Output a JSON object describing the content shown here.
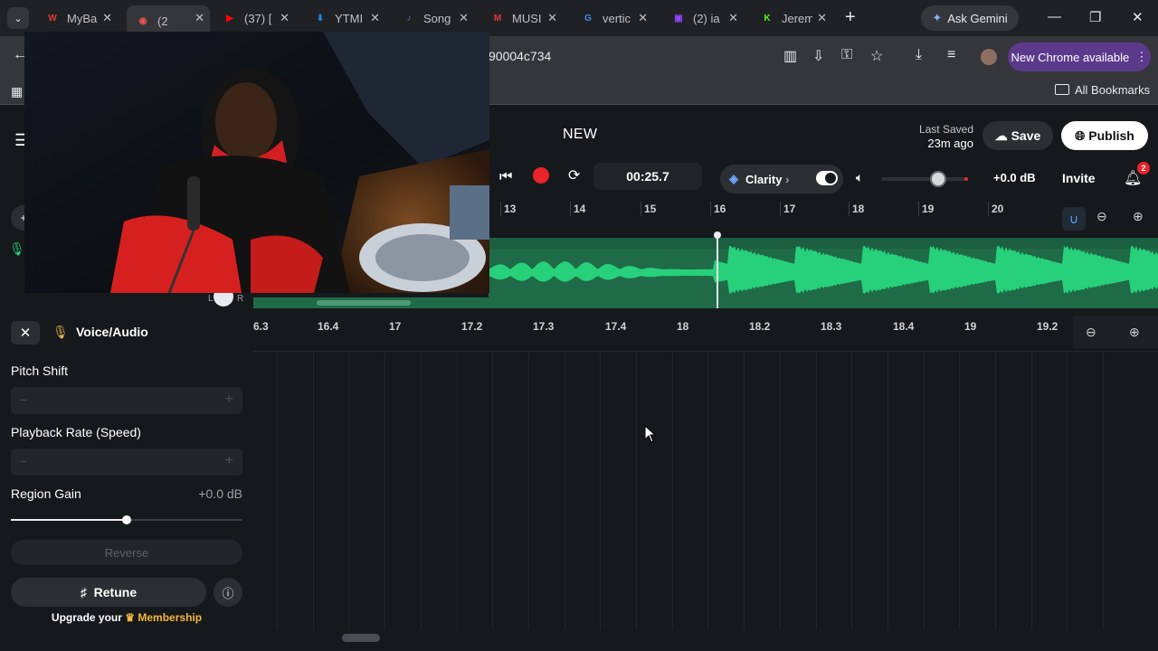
{
  "browser": {
    "tabs": [
      {
        "title": "MyBa",
        "icon": "W",
        "color": "#e53935"
      },
      {
        "title": "(2",
        "icon": "rec",
        "color": "#ef5350"
      },
      {
        "title": "(37) [",
        "icon": "yt",
        "color": "#ff0000"
      },
      {
        "title": "YTMI",
        "icon": "dl",
        "color": "#1e88e5"
      },
      {
        "title": "Song",
        "icon": "note",
        "color": "#5c6bc0"
      },
      {
        "title": "MUSI",
        "icon": "M",
        "color": "#e53935"
      },
      {
        "title": "vertic",
        "icon": "G",
        "color": "#4285f4"
      },
      {
        "title": "(2) ia",
        "icon": "tw",
        "color": "#9146ff"
      },
      {
        "title": "Jerem",
        "icon": "K",
        "color": "#53fc18"
      }
    ],
    "gemini_label": "Ask Gemini",
    "url": "90004c734",
    "new_chrome_label": "New Chrome available",
    "all_bookmarks_label": "All Bookmarks"
  },
  "app": {
    "project_title": "NEW",
    "last_saved_label": "Last Saved",
    "last_saved_value": "23m ago",
    "save_label": "Save",
    "publish_label": "Publish",
    "time": "00:25.7",
    "clarity_label": "Clarity",
    "volume_db": "+0.0 dB",
    "volume_level": 0.66,
    "invite_label": "Invite",
    "notification_count": "2",
    "ruler_top": [
      "13",
      "14",
      "15",
      "16",
      "17",
      "18",
      "19",
      "20"
    ],
    "ruler_bottom": [
      "6.3",
      "16.4",
      "17",
      "17.2",
      "17.3",
      "17.4",
      "18",
      "18.2",
      "18.3",
      "18.4",
      "19",
      "19.2"
    ],
    "pan_left": "L",
    "pan_right": "R"
  },
  "panel": {
    "title": "Voice/Audio",
    "pitch_shift_label": "Pitch Shift",
    "playback_rate_label": "Playback Rate (Speed)",
    "region_gain_label": "Region Gain",
    "region_gain_value": "+0.0 dB",
    "region_gain_level": 0.5,
    "reverse_label": "Reverse",
    "retune_label": "Retune",
    "upgrade_text": "Upgrade your",
    "membership_label": "Membership",
    "stepper_minus": "−",
    "stepper_plus": "+"
  },
  "colors": {
    "accent_green": "#27d07a",
    "track_bg": "#1f6b47",
    "record_red": "#e8232a"
  }
}
